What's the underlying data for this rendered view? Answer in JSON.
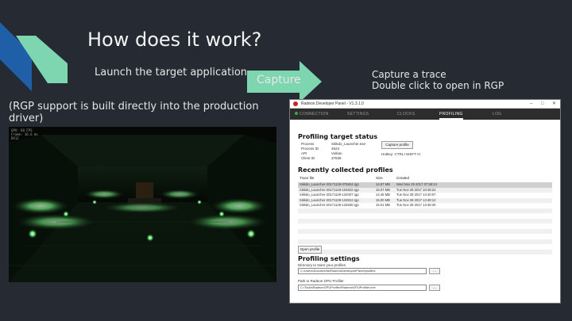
{
  "slide": {
    "title": "How does it work?",
    "step1": "Launch the target application",
    "note": "(RGP support is built directly into the production driver)",
    "arrow_label": "Capture",
    "step3_line1": "Capture a trace",
    "step3_line2": "Double click to open in RGP"
  },
  "colors": {
    "background": "#262a33",
    "accent_teal": "#7ed6b0",
    "accent_blue": "#1e5fa8"
  },
  "game": {
    "hud_lines": [
      "GPU: 60 FPS",
      "Frame: 16.6 ms",
      "DX12"
    ]
  },
  "panel": {
    "window_title": "Radeon Developer Panel - V1.3.1.0",
    "tabs": [
      "CONNECTION",
      "SETTINGS",
      "CLOCKS",
      "PROFILING",
      "LOG"
    ],
    "active_tab": "PROFILING",
    "target_status_heading": "Profiling target status",
    "status_labels": [
      "Process",
      "Process ID",
      "API",
      "Client ID"
    ],
    "status_values": [
      "Sikkdo_Launcher.exe",
      "4923",
      "Vulkan",
      "37638"
    ],
    "capture_button": "Capture profile",
    "hotkey_hint": "Hotkey: CTRL+SHIFT+C",
    "recent_heading": "Recently collected profiles",
    "columns": [
      "Trace file",
      "Size",
      "Created"
    ],
    "rows": [
      {
        "file": "Sikkdo_Launcher-20171128-075824.rgp",
        "size": "14.97 MB",
        "created": "Wed Nov 29 2017 07:58:24"
      },
      {
        "file": "Sikkdo_Launcher-20171128-104822.rgp",
        "size": "16.07 MB",
        "created": "Tue Nov 28 2017 10:48:22"
      },
      {
        "file": "Sikkdo_Launcher-20171128-134007.rgp",
        "size": "14.45 MB",
        "created": "Tue Nov 28 2017 13:40:07"
      },
      {
        "file": "Sikkdo_Launcher-20171128-134812.rgp",
        "size": "15.00 MB",
        "created": "Tue Nov 28 2017 13:48:12"
      },
      {
        "file": "Sikkdo_Launcher-20171128-134830.rgp",
        "size": "15.01 MB",
        "created": "Tue Nov 28 2017 13:48:30"
      }
    ],
    "open_button": "Open profile",
    "settings_heading": "Profiling settings",
    "dir_label": "Directory to store your profiles",
    "dir_value": "C:\\Users\\Documents\\RadeonDeveloperPanel\\profiles",
    "browse_label": "...",
    "rgp_path_label": "Path to Radeon GPU Profiler",
    "rgp_path_value": "C:\\Tools\\RadeonGPUProfiler\\RadeonGPUProfiler.exe"
  }
}
